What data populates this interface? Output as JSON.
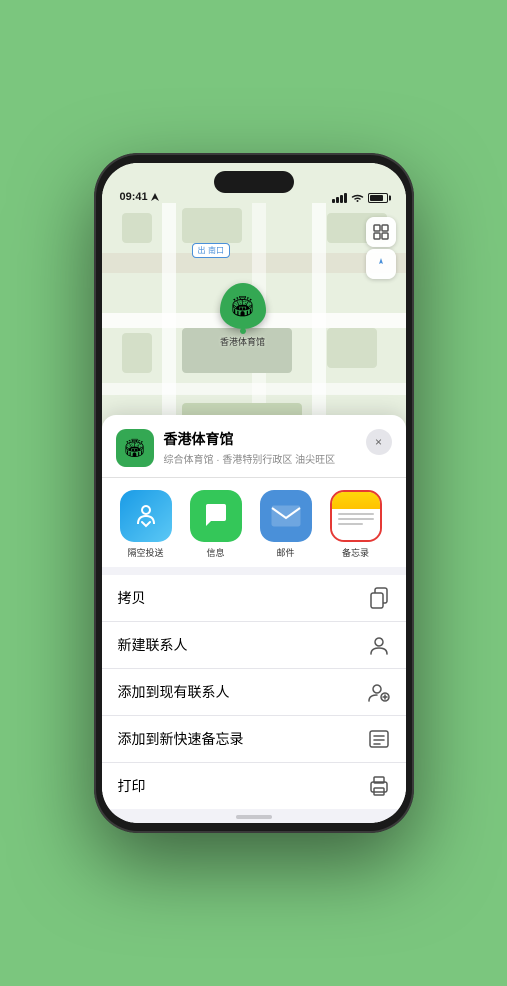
{
  "status_bar": {
    "time": "09:41",
    "location_arrow": "▶"
  },
  "map": {
    "label": "南口",
    "controls": {
      "map_view": "🗺",
      "location": "⬆"
    }
  },
  "venue": {
    "name": "香港体育馆",
    "subtitle": "综合体育馆 · 香港特别行政区 油尖旺区",
    "icon": "🏟"
  },
  "apps": [
    {
      "id": "airdrop",
      "label": "隔空投送",
      "icon": "📡"
    },
    {
      "id": "messages",
      "label": "信息",
      "icon": "💬"
    },
    {
      "id": "mail",
      "label": "邮件",
      "icon": "✉"
    },
    {
      "id": "notes",
      "label": "备忘录",
      "icon": "notes"
    }
  ],
  "actions": [
    {
      "label": "拷贝",
      "icon": "📋"
    },
    {
      "label": "新建联系人",
      "icon": "👤"
    },
    {
      "label": "添加到现有联系人",
      "icon": "👥"
    },
    {
      "label": "添加到新快速备忘录",
      "icon": "📝"
    },
    {
      "label": "打印",
      "icon": "🖨"
    }
  ],
  "close_label": "×",
  "marker_label": "香港体育馆"
}
